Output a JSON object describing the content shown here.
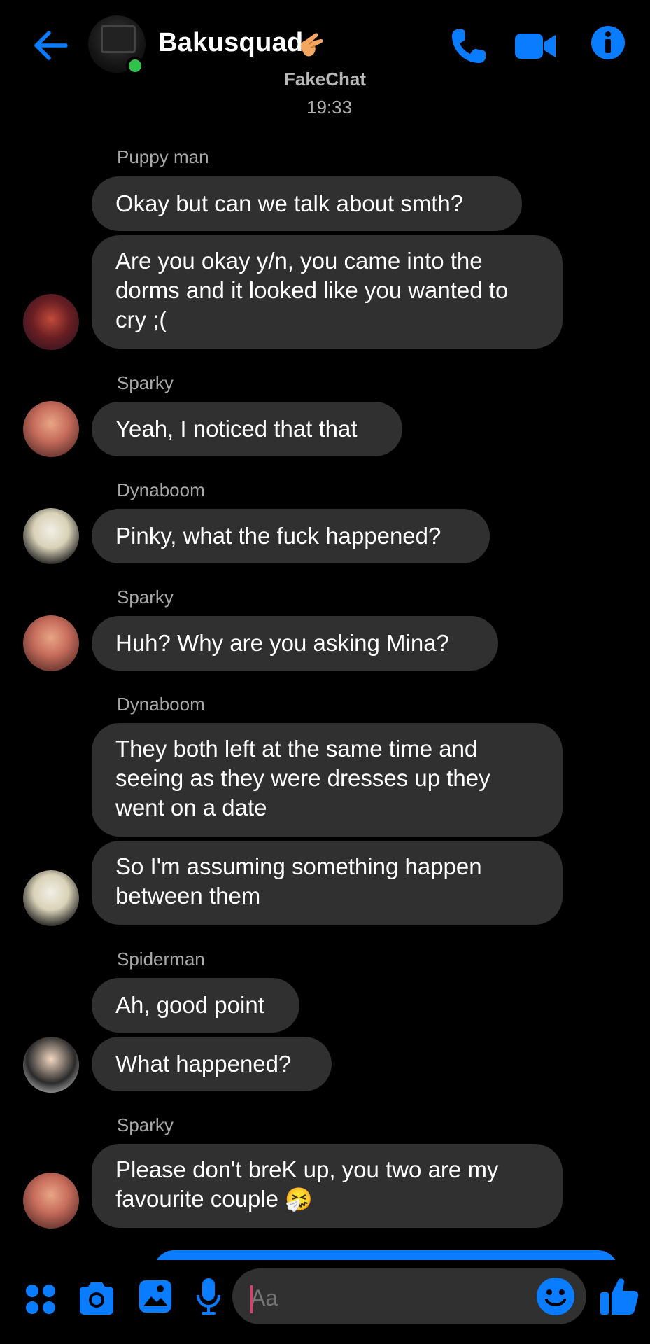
{
  "header": {
    "title": "Bakusquad",
    "watermark": "FakeChat",
    "time": "19:33",
    "title_emoji": "finger-crossed-emoji"
  },
  "messages": [
    {
      "sender": "Puppy man",
      "bubbles": [
        "Okay but can we talk about smth?",
        "Are you okay y/n, you came into the dorms and it looked like you wanted to cry ;("
      ]
    },
    {
      "sender": "Sparky",
      "bubbles": [
        "Yeah, I noticed that that"
      ]
    },
    {
      "sender": "Dynaboom",
      "bubbles": [
        "Pinky, what the fuck happened?"
      ]
    },
    {
      "sender": "Sparky",
      "bubbles": [
        "Huh? Why are you asking Mina?"
      ]
    },
    {
      "sender": "Dynaboom",
      "bubbles": [
        "They both left at the same time and seeing as they were dresses up they went on a date",
        "So I'm assuming something happen between them"
      ]
    },
    {
      "sender": "Spiderman",
      "bubbles": [
        "Ah, good point",
        "What happened?"
      ]
    },
    {
      "sender": "Sparky",
      "bubbles": [
        "Please don't breK up, you two are my favourite couple",
        "🤧"
      ]
    }
  ],
  "composer": {
    "placeholder": "Aa"
  },
  "colors": {
    "accent": "#0a7cff",
    "bubble": "#303030",
    "online": "#31c24d",
    "background": "#000000"
  }
}
